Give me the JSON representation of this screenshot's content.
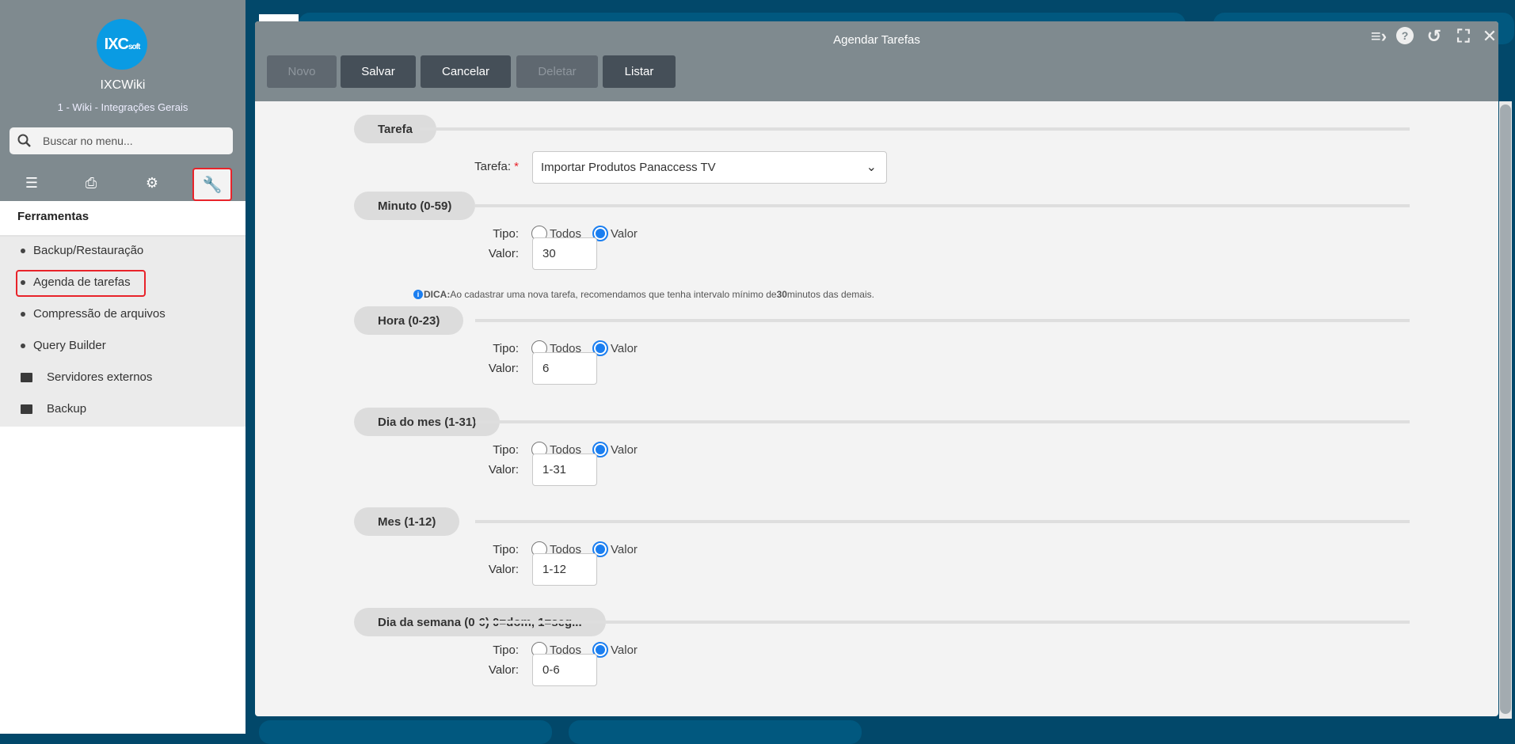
{
  "sidebar": {
    "logo_text": "IXCsoft",
    "app_name": "IXCWiki",
    "subtitle": "1 - Wiki - Integrações Gerais",
    "search_placeholder": "Buscar no menu...",
    "tabs": [
      "list-icon",
      "printer-icon",
      "gears-icon",
      "wrench-icon"
    ],
    "active_tab": "wrench-icon",
    "section_title": "Ferramentas",
    "items": [
      {
        "label": "Backup/Restauração",
        "type": "item"
      },
      {
        "label": "Agenda de tarefas",
        "type": "item",
        "highlighted": true
      },
      {
        "label": "Compressão de arquivos",
        "type": "item"
      },
      {
        "label": "Query Builder",
        "type": "item"
      },
      {
        "label": "Servidores externos",
        "type": "folder"
      },
      {
        "label": "Backup",
        "type": "folder"
      }
    ]
  },
  "modal": {
    "title": "Agendar Tarefas",
    "header_icons": [
      "collapse-menu-icon",
      "help-icon",
      "history-icon",
      "fullscreen-icon",
      "close-icon"
    ],
    "buttons": [
      {
        "label": "Novo",
        "disabled": true
      },
      {
        "label": "Salvar",
        "disabled": false
      },
      {
        "label": "Cancelar",
        "disabled": false
      },
      {
        "label": "Deletar",
        "disabled": true
      },
      {
        "label": "Listar",
        "disabled": false
      }
    ],
    "tarefa_section": "Tarefa",
    "tarefa_label": "Tarefa:",
    "required_mark": "*",
    "tarefa_value": "Importar Produtos Panaccess TV",
    "tipo_label": "Tipo:",
    "valor_label": "Valor:",
    "option_todos": "Todos",
    "option_valor": "Valor",
    "dica": {
      "prefix": "DICA:",
      "text": "Ao cadastrar uma nova tarefa, recomendamos que tenha intervalo mínimo de ",
      "bold": "30",
      "suffix": " minutos das demais."
    },
    "sections": [
      {
        "label": "Minuto (0-59)",
        "selected": "Valor",
        "value": "30"
      },
      {
        "label": "Hora (0-23)",
        "selected": "Valor",
        "value": "6"
      },
      {
        "label": "Dia do mes (1-31)",
        "selected": "Valor",
        "value": "1-31"
      },
      {
        "label": "Mes (1-12)",
        "selected": "Valor",
        "value": "1-12"
      },
      {
        "label": "Dia da semana (0-6) 0=dom, 1=seg...",
        "selected": "Valor",
        "value": "0-6"
      }
    ]
  },
  "colors": {
    "accent": "#1a7ef0",
    "highlight": "#e8232a",
    "header": "#7f8a8f",
    "background": "#02486a"
  }
}
